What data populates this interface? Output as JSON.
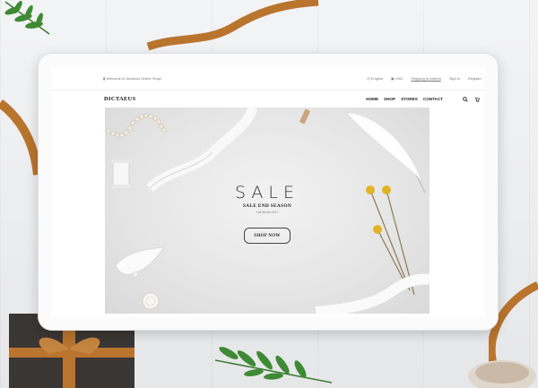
{
  "topbar": {
    "welcome": "Welcome to Dictaeus Online Shop!",
    "language": "English",
    "currency": "USD",
    "shipping": "Shipping to Alberta",
    "signin": "Sign in",
    "register": "Register"
  },
  "navbar": {
    "logo": "DICTAEUS",
    "links": [
      "HOME",
      "SHOP",
      "STORES",
      "CONTACT"
    ]
  },
  "hero": {
    "title": "SALE",
    "subtitle": "SALE END SEASON",
    "note": "Fall Winter 2017",
    "cta": "SHOP NOW"
  },
  "colors": {
    "ribbon": "#b9742e",
    "leaf": "#3f8a35",
    "flower": "#e3b324",
    "hero_bg": "#e6e6e6"
  }
}
